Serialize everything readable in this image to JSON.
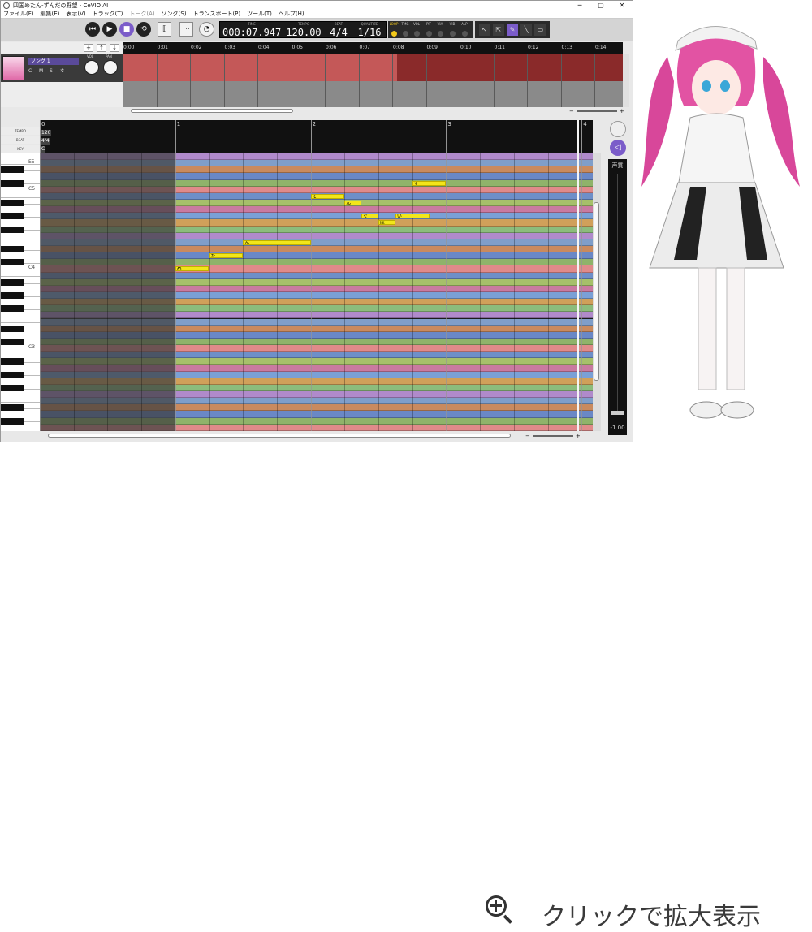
{
  "window": {
    "title": "四国めたん-ずんだの野望 - CeVIO AI",
    "min": "─",
    "max": "▢",
    "close": "✕"
  },
  "menu": [
    "ファイル(F)",
    "編集(E)",
    "表示(V)",
    "トラック(T)",
    "トーク(A)",
    "ソング(S)",
    "トランスポート(P)",
    "ツール(T)",
    "ヘルプ(H)"
  ],
  "transport": {
    "rewind": "⏮",
    "play": "▶",
    "stop": "■",
    "loop": "⟲"
  },
  "display": {
    "time": "000:07.947",
    "tempo": "120.00",
    "beat": "4/4",
    "quantize": "1/16",
    "time_cap": "TIME",
    "tempo_cap": "TEMPO",
    "beat_cap": "BEAT",
    "quantize_cap": "QUANTIZE"
  },
  "mix_labels": [
    "LOOP",
    "TMG",
    "VOL",
    "PIT",
    "VIA",
    "VIB",
    "ALP"
  ],
  "tools": [
    "↖",
    "⇱",
    "✎",
    "╲",
    "▭"
  ],
  "track": {
    "name": "ソング 1",
    "mute": "C",
    "m": "M",
    "s": "S",
    "gear": "✲",
    "vol_label": "VOL",
    "pan_label": "PAN",
    "add": "+",
    "up": "↑",
    "down": "↓"
  },
  "timeline_ticks": [
    "0:00",
    "0:01",
    "0:02",
    "0:03",
    "0:04",
    "0:05",
    "0:06",
    "0:07",
    "0:08",
    "0:09",
    "0:10",
    "0:11",
    "0:12",
    "0:13",
    "0:14"
  ],
  "roll": {
    "tempo_label": "TEMPO",
    "beat_label": "BEAT",
    "key_label": "KEY",
    "tempo_value": "120",
    "beat_value": "4/4",
    "key_value": "C",
    "measures": [
      "0",
      "1",
      "2",
      "3",
      "4"
    ],
    "key_labels": [
      "E5",
      "C5",
      "C5",
      "C4",
      "C3"
    ],
    "notes": [
      {
        "lyric": "め",
        "start": 4,
        "len": 1,
        "pitch": 60
      },
      {
        "lyric": "た",
        "start": 5,
        "len": 1,
        "pitch": 62
      },
      {
        "lyric": "ん",
        "start": 6,
        "len": 2,
        "pitch": 64
      },
      {
        "lyric": "そ",
        "start": 8,
        "len": 1,
        "pitch": 71
      },
      {
        "lyric": "ん",
        "start": 9,
        "len": 0.5,
        "pitch": 70
      },
      {
        "lyric": "ぐ",
        "start": 9.5,
        "len": 0.5,
        "pitch": 68
      },
      {
        "lyric": "ぼ",
        "start": 10,
        "len": 0.5,
        "pitch": 67
      },
      {
        "lyric": "い",
        "start": 10.5,
        "len": 1,
        "pitch": 68
      },
      {
        "lyric": "ず",
        "start": 11,
        "len": 1,
        "pitch": 73
      }
    ]
  },
  "voice": {
    "label": "声質",
    "value": "-1.00"
  },
  "caption": "クリックで拡大表示",
  "colors": {
    "accent": "#7b5cc9",
    "note": "#f2e61a",
    "track_region": "#8a2a2a"
  }
}
